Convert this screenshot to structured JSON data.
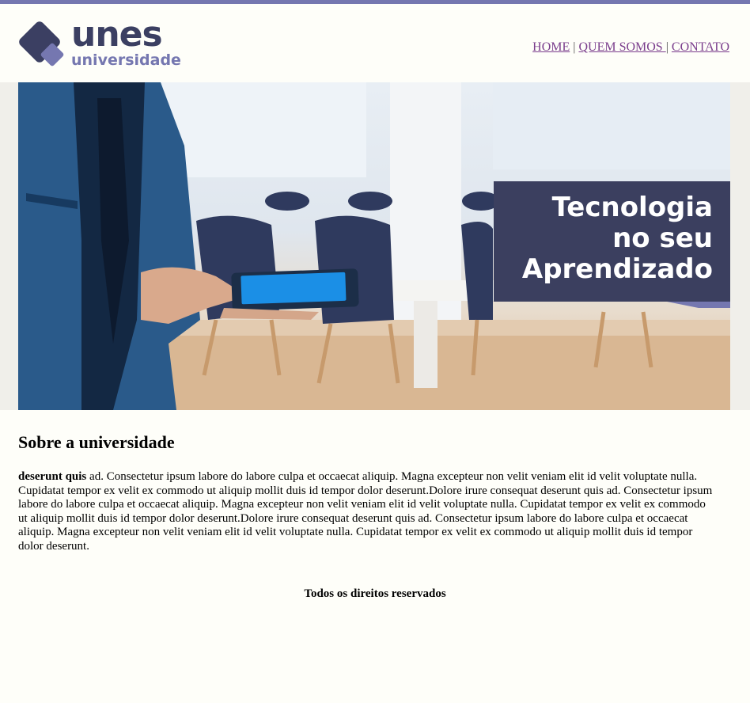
{
  "brand": {
    "name": "unes",
    "subtitle": "universidade",
    "primary_color": "#3b3f62",
    "accent_color": "#7577b0"
  },
  "nav": {
    "home": "HOME",
    "about": "QUEM SOMOS ",
    "contact": "CONTATO",
    "separator": "|",
    "link_color": "#7a3d8c"
  },
  "banner": {
    "line1": "Tecnologia",
    "line2": "no seu",
    "line3": "Aprendizado",
    "image": "person-with-tablet-in-meeting-room"
  },
  "about": {
    "heading": "Sobre a universidade",
    "bold_lead": "deserunt quis",
    "body": " ad. Consectetur ipsum labore do labore culpa et occaecat aliquip. Magna excepteur non velit veniam elit id velit voluptate nulla. Cupidatat tempor ex velit ex commodo ut aliquip mollit duis id tempor dolor deserunt.Dolore irure consequat deserunt quis ad. Consectetur ipsum labore do labore culpa et occaecat aliquip. Magna excepteur non velit veniam elit id velit voluptate nulla. Cupidatat tempor ex velit ex commodo ut aliquip mollit duis id tempor dolor deserunt.Dolore irure consequat deserunt quis ad. Consectetur ipsum labore do labore culpa et occaecat aliquip. Magna excepteur non velit veniam elit id velit voluptate nulla. Cupidatat tempor ex velit ex commodo ut aliquip mollit duis id tempor dolor deserunt."
  },
  "footer": {
    "text": "Todos os direitos reservados"
  }
}
